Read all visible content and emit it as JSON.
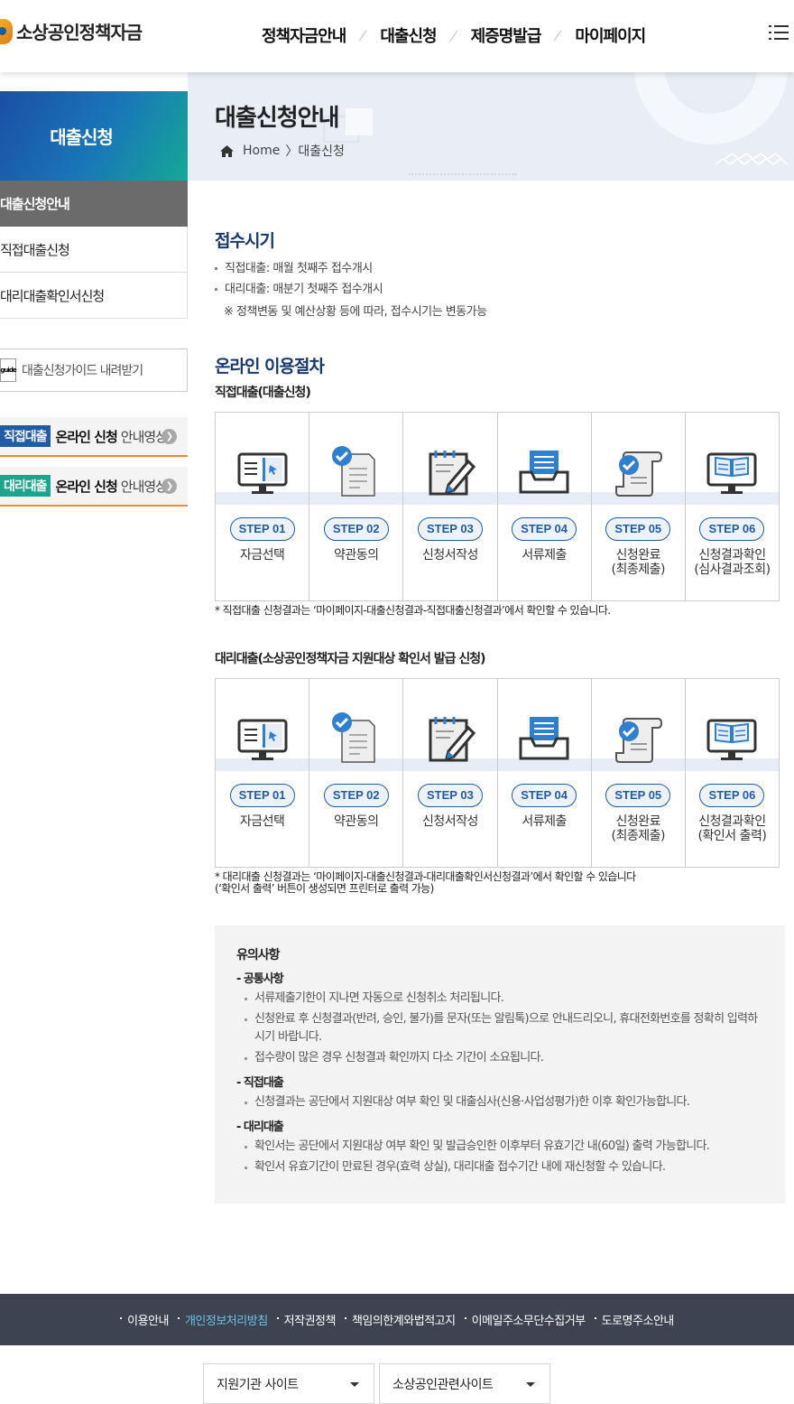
{
  "header": {
    "logo_text": "소상공인정책자금",
    "nav": [
      "정책자금안내",
      "대출신청",
      "제증명발급",
      "마이페이지"
    ]
  },
  "sidebar": {
    "title": "대출신청",
    "items": [
      {
        "label": "대출신청안내",
        "active": true
      },
      {
        "label": "직접대출신청",
        "active": false
      },
      {
        "label": "대리대출확인서신청",
        "active": false
      }
    ],
    "guide_icon_text": "guide",
    "guide_label": "대출신청가이드 내려받기",
    "videos": [
      {
        "tag": "직접대출",
        "strong": "온라인 신청",
        "rest": "안내영상",
        "color": "#1f5ca8"
      },
      {
        "tag": "대리대출",
        "strong": "온라인 신청",
        "rest": "안내영상",
        "color": "#1aa58c"
      }
    ]
  },
  "banner": {
    "title": "대출신청안내",
    "breadcrumb_home": "Home",
    "breadcrumb_current": "〉대출신청"
  },
  "reception": {
    "heading": "접수시기",
    "items": [
      "직접대출: 매월 첫째주 접수개시",
      "대리대출: 매분기 첫째주 접수개시"
    ],
    "note": "※ 정책변동 및 예산상황 등에 따라, 접수시기는 변동가능"
  },
  "procedure": {
    "heading": "온라인 이용절차",
    "direct": {
      "title": "직접대출(대출신청)",
      "steps": [
        {
          "badge": "STEP 01",
          "label": "자금선택",
          "icon": "monitor-cursor-icon"
        },
        {
          "badge": "STEP 02",
          "label": "약관동의",
          "icon": "document-check-icon"
        },
        {
          "badge": "STEP 03",
          "label": "신청서작성",
          "icon": "notepad-pen-icon"
        },
        {
          "badge": "STEP 04",
          "label": "서류제출",
          "icon": "inbox-tray-icon"
        },
        {
          "badge": "STEP 05",
          "label": "신청완료\n(최종제출)",
          "icon": "scroll-check-icon"
        },
        {
          "badge": "STEP 06",
          "label": "신청결과확인\n(심사결과조회)",
          "icon": "monitor-book-icon"
        }
      ],
      "note": "* 직접대출 신청결과는 ‘마이페이지-대출신청결과-직접대출신청결과’에서 확인할 수 있습니다."
    },
    "proxy": {
      "title": "대리대출(소상공인정책자금 지원대상 확인서 발급 신청)",
      "steps": [
        {
          "badge": "STEP 01",
          "label": "자금선택",
          "icon": "monitor-cursor-icon"
        },
        {
          "badge": "STEP 02",
          "label": "약관동의",
          "icon": "document-check-icon"
        },
        {
          "badge": "STEP 03",
          "label": "신청서작성",
          "icon": "notepad-pen-icon"
        },
        {
          "badge": "STEP 04",
          "label": "서류제출",
          "icon": "inbox-tray-icon"
        },
        {
          "badge": "STEP 05",
          "label": "신청완료\n(최종제출)",
          "icon": "scroll-check-icon"
        },
        {
          "badge": "STEP 06",
          "label": "신청결과확인\n(확인서 출력)",
          "icon": "monitor-book-icon"
        }
      ],
      "note1": "* 대리대출 신청결과는 ‘마이페이지-대출신청결과-대리대출확인서신청결과’에서 확인할 수 있습니다",
      "note2": "(‘확인서 출력’ 버튼이 생성되면 프린터로 출력 가능)"
    }
  },
  "notice": {
    "title": "유의사항",
    "sections": [
      {
        "sub": "- 공통사항",
        "items": [
          "서류제출기한이 지나면 자동으로 신청취소 처리됩니다.",
          "신청완료 후 신청결과(반려, 승인, 불가)를 문자(또는 알림톡)으로 안내드리오니, 휴대전화번호를 정확히 입력하시기 바랍니다.",
          "접수량이 많은 경우 신청결과 확인까지 다소 기간이 소요됩니다."
        ]
      },
      {
        "sub": "- 직접대출",
        "items": [
          "신청결과는 공단에서 지원대상 여부 확인 및 대출심사(신용·사업성평가)한 이후 확인가능합니다."
        ]
      },
      {
        "sub": "- 대리대출",
        "items": [
          "확인서는 공단에서 지원대상 여부 확인 및 발급승인한 이후부터 유효기간 내(60일) 출력 가능합니다.",
          "확인서 유효기간이 만료된 경우(효력 상실), 대리대출 접수기간 내에 재신청할 수 있습니다."
        ]
      }
    ]
  },
  "footer": {
    "links": [
      {
        "label": "이용안내",
        "highlight": false
      },
      {
        "label": "개인정보처리방침",
        "highlight": true
      },
      {
        "label": "저작권정책",
        "highlight": false
      },
      {
        "label": "책임의한계와법적고지",
        "highlight": false
      },
      {
        "label": "이메일주소무단수집거부",
        "highlight": false
      },
      {
        "label": "도로명주소안내",
        "highlight": false
      }
    ],
    "select1": "지원기관 사이트",
    "select2": "소상공인관련사이트"
  }
}
